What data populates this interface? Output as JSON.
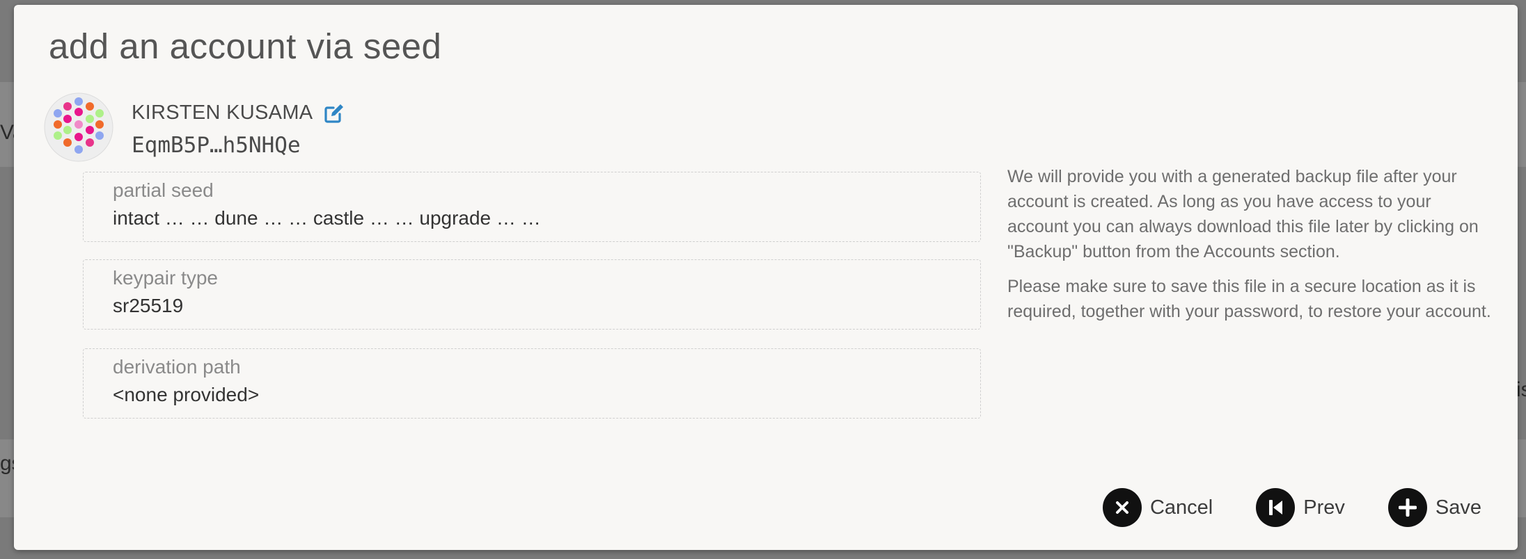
{
  "modal": {
    "title": "add an account via seed"
  },
  "account": {
    "name": "KIRSTEN KUSAMA",
    "address": "EqmB5P…h5NHQe"
  },
  "fields": [
    {
      "label": "partial seed",
      "value": "intact … … dune … … castle … … upgrade … …"
    },
    {
      "label": "keypair type",
      "value": "sr25519"
    },
    {
      "label": "derivation path",
      "value": "<none provided>"
    }
  ],
  "help": {
    "paragraph_1": "We will provide you with a generated backup file after your account is created. As long as you have access to your account you can always download this file later by clicking on \"Backup\" button from the Accounts section.",
    "paragraph_2": "Please make sure to save this file in a secure location as it is required, together with your password, to restore your account."
  },
  "actions": {
    "cancel_label": "Cancel",
    "prev_label": "Prev",
    "save_label": "Save"
  },
  "background": {
    "fragment_left_1": "Va",
    "fragment_left_2": "gs",
    "fragment_right": "is"
  },
  "icons": {
    "edit": "edit-icon",
    "cancel": "close-icon",
    "prev": "skip-back-icon",
    "save": "plus-icon"
  },
  "colors": {
    "accent": "#2f86c5",
    "button": "#111111",
    "modal_background": "#f8f7f5"
  }
}
